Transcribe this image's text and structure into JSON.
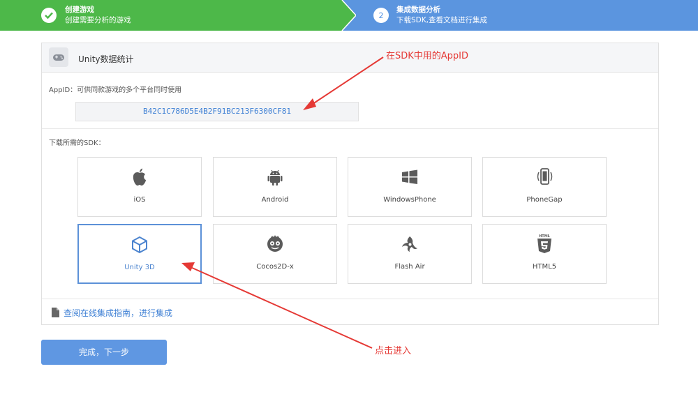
{
  "steps": [
    {
      "title": "创建游戏",
      "subtitle": "创建需要分析的游戏"
    },
    {
      "number": "2",
      "title": "集成数据分析",
      "subtitle": "下载SDK,查看文档进行集成"
    }
  ],
  "card": {
    "title": "Unity数据统计",
    "appid_label": "AppID：可供同款游戏的多个平台同时使用",
    "appid_value": "B42C1C786D5E4B2F91BC213F6300CF81",
    "sdk_label": "下载所需的SDK：",
    "platforms": [
      {
        "label": "iOS",
        "icon": "apple-icon"
      },
      {
        "label": "Android",
        "icon": "android-icon"
      },
      {
        "label": "WindowsPhone",
        "icon": "windows-icon"
      },
      {
        "label": "PhoneGap",
        "icon": "phonegap-icon"
      },
      {
        "label": "Unity 3D",
        "icon": "unity-icon",
        "selected": true
      },
      {
        "label": "Cocos2D-x",
        "icon": "cocos-icon"
      },
      {
        "label": "Flash Air",
        "icon": "flash-air-icon"
      },
      {
        "label": "HTML5",
        "icon": "html5-icon"
      }
    ],
    "guide_link": "查阅在线集成指南，进行集成"
  },
  "next_button": "完成，下一步",
  "annotations": {
    "appid_note": "在SDK中用的AppID",
    "click_note": "点击进入"
  },
  "colors": {
    "step_done": "#4db849",
    "step_active": "#5b95df",
    "link": "#3d7fd4",
    "annotation": "#e53935"
  }
}
